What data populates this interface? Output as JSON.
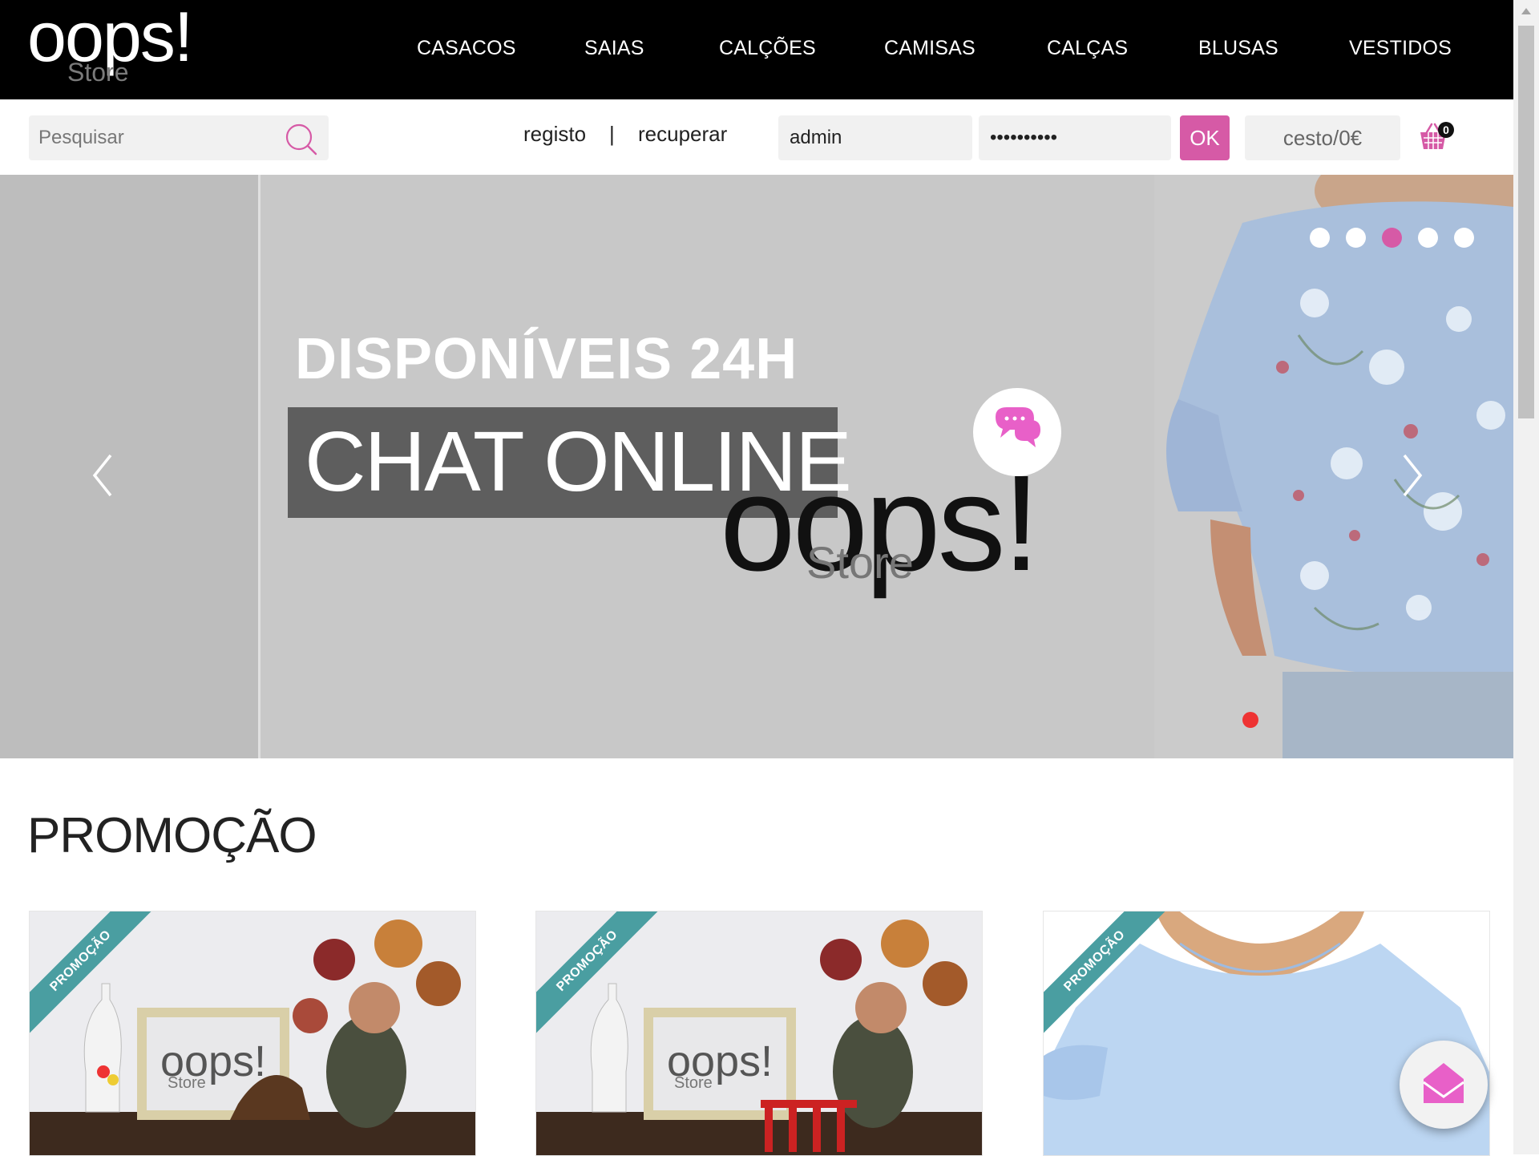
{
  "header": {
    "logo_text": "oops!",
    "logo_sub": "Store",
    "nav": [
      "CASACOS",
      "SAIAS",
      "CALÇÕES",
      "CAMISAS",
      "CALÇAS",
      "BLUSAS",
      "VESTIDOS"
    ]
  },
  "toolbar": {
    "search_placeholder": "Pesquisar",
    "registo_label": "registo",
    "separator": "|",
    "recuperar_label": "recuperar",
    "username_value": "admin",
    "password_value": "••••••••••",
    "ok_label": "OK",
    "cart_total": "cesto/0€",
    "cart_count": "0"
  },
  "hero": {
    "kicker": "DISPONÍVEIS 24H",
    "title": "CHAT ONLINE",
    "logo_text": "oops!",
    "logo_sub": "Store",
    "slide_count": 5,
    "active_slide": 3
  },
  "promo": {
    "title": "PROMOÇÃO",
    "cards": [
      {
        "ribbon": "PROMOÇÃO",
        "frame_text": "oops!",
        "frame_sub": "Store"
      },
      {
        "ribbon": "PROMOÇÃO",
        "frame_text": "oops!",
        "frame_sub": "Store"
      },
      {
        "ribbon": "PROMOÇÃO"
      }
    ]
  },
  "colors": {
    "accent": "#d65aa6",
    "ribbon": "#4a9ea1",
    "topbar": "#000000"
  },
  "icons": {
    "search": "search-icon",
    "cart": "basket-icon",
    "chat": "chat-icon",
    "mail": "mail-icon"
  }
}
